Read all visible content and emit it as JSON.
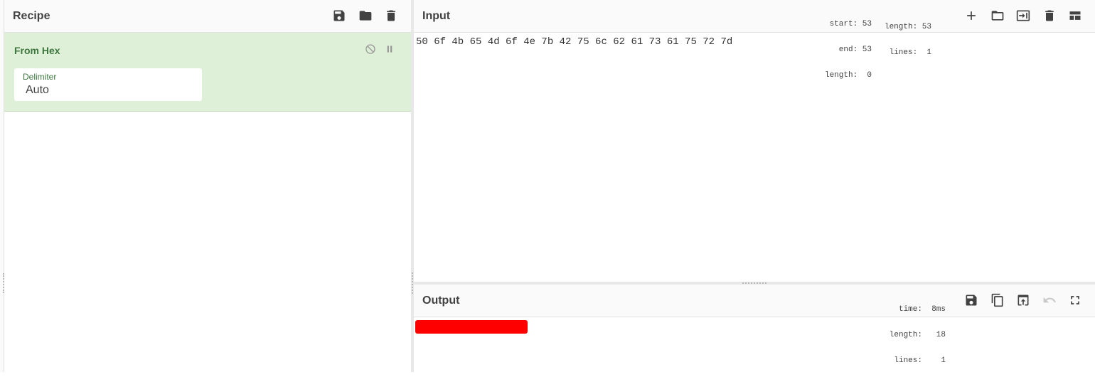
{
  "recipe": {
    "title": "Recipe",
    "icons": [
      "save-icon",
      "folder-icon",
      "trash-icon"
    ],
    "operation": {
      "name": "From Hex",
      "icons": [
        "disable-icon",
        "breakpoint-icon"
      ],
      "arg_label": "Delimiter",
      "arg_value": "Auto"
    }
  },
  "input": {
    "title": "Input",
    "stats": {
      "start": "start: 53",
      "end": "end: 53",
      "sel_length": "length:  0",
      "length": "length: 53",
      "lines": "lines:  1"
    },
    "icons": [
      "plus-icon",
      "folder-icon",
      "load-input-icon",
      "trash-icon",
      "layout-icon"
    ],
    "text": "50 6f 4b 65 4d 6f 4e 7b 42 75 6c 62 61 73 61 75 72 7d"
  },
  "output": {
    "title": "Output",
    "stats": {
      "time": "time:  8ms",
      "length": "length:   18",
      "lines": "lines:    1"
    },
    "icons": [
      "save-icon",
      "copy-icon",
      "replace-input-icon",
      "undo-icon",
      "fullscreen-icon"
    ],
    "redacted_color": "#ff0000"
  },
  "colors": {
    "op_bg": "#dff0d8",
    "op_text": "#3c763d"
  }
}
